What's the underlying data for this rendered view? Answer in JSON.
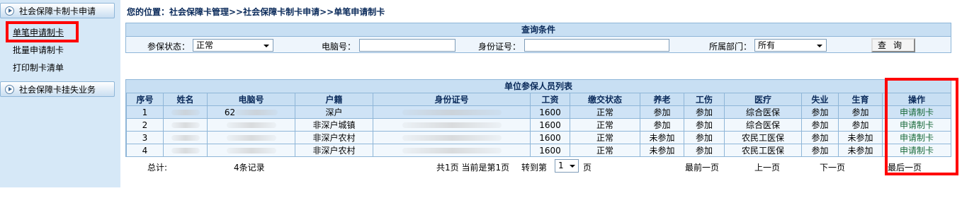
{
  "sidebar": {
    "group1": "社会保障卡制卡申请",
    "items": [
      "单笔申请制卡",
      "批量申请制卡",
      "打印制卡清单"
    ],
    "group2": "社会保障卡挂失业务"
  },
  "breadcrumb": "您的位置：社会保障卡管理>>社会保障卡制卡申请>>单笔申请制卡",
  "query": {
    "title": "查询条件",
    "status_label": "参保状态：",
    "status_value": "正常",
    "computer_no_label": "电脑号：",
    "computer_no_value": "",
    "id_label": "身份证号：",
    "id_value": "",
    "dept_label": "所属部门：",
    "dept_value": "所有",
    "search_button": "查询"
  },
  "list": {
    "title": "单位参保人员列表",
    "columns": [
      "序号",
      "姓名",
      "电脑号",
      "户籍",
      "身份证号",
      "工资",
      "缴交状态",
      "养老",
      "工伤",
      "医疗",
      "失业",
      "生育",
      "操作"
    ],
    "rows": [
      {
        "no": "1",
        "name": "",
        "computer_no": "62",
        "huji": "深户",
        "id": "",
        "salary": "1600",
        "status": "正常",
        "yanglao": "参加",
        "gongshang": "参加",
        "yiliao": "综合医保",
        "shiye": "参加",
        "shengyu": "参加",
        "action": "申请制卡"
      },
      {
        "no": "2",
        "name": "",
        "computer_no": "",
        "huji": "非深户城镇",
        "id": "",
        "salary": "1600",
        "status": "正常",
        "yanglao": "参加",
        "gongshang": "参加",
        "yiliao": "综合医保",
        "shiye": "参加",
        "shengyu": "参加",
        "action": "申请制卡"
      },
      {
        "no": "3",
        "name": "",
        "computer_no": "",
        "huji": "非深户农村",
        "id": "",
        "salary": "1600",
        "status": "正常",
        "yanglao": "未参加",
        "gongshang": "参加",
        "yiliao": "农民工医保",
        "shiye": "参加",
        "shengyu": "未参加",
        "action": "申请制卡"
      },
      {
        "no": "4",
        "name": "",
        "computer_no": "",
        "huji": "非深户农村",
        "id": "",
        "salary": "1600",
        "status": "正常",
        "yanglao": "未参加",
        "gongshang": "参加",
        "yiliao": "农民工医保",
        "shiye": "参加",
        "shengyu": "未参加",
        "action": "申请制卡"
      }
    ]
  },
  "footer": {
    "total_label": "总计:",
    "total_value": "4条记录",
    "page_info": "共1页  当前是第1页",
    "goto_label": "转到第",
    "page_value": "1",
    "page_unit": "页",
    "first": "最前一页",
    "prev": "上一页",
    "next": "下一页",
    "last": "最后一页"
  },
  "colors": {
    "highlight_box": "#ff0000",
    "header_bg": "#c8dff3",
    "sidebar_bg": "#d6e8f7",
    "action_link": "#1a6b3a"
  }
}
